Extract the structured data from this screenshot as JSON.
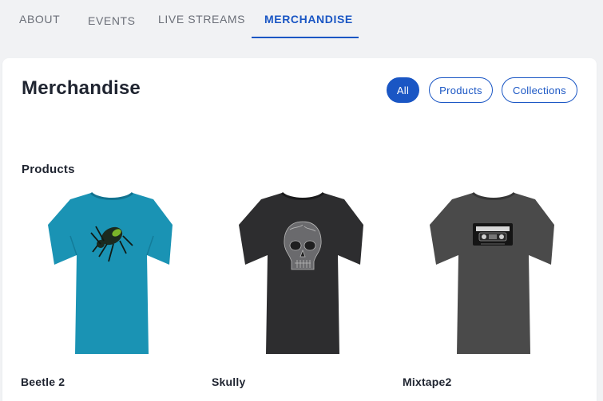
{
  "tabs": [
    {
      "label": "ABOUT",
      "active": false
    },
    {
      "label": "EVENTS",
      "active": false
    },
    {
      "label": "LIVE STREAMS",
      "active": false
    },
    {
      "label": "MERCHANDISE",
      "active": true
    }
  ],
  "page": {
    "title": "Merchandise",
    "filters": [
      {
        "label": "All",
        "active": true
      },
      {
        "label": "Products",
        "active": false
      },
      {
        "label": "Collections",
        "active": false
      }
    ],
    "section_title": "Products"
  },
  "products": [
    {
      "name": "Beetle 2",
      "shirt_color": "#1a93b4",
      "graphic": "beetle-icon"
    },
    {
      "name": "Skully",
      "shirt_color": "#2d2d2f",
      "graphic": "skull-icon"
    },
    {
      "name": "Mixtape2",
      "shirt_color": "#4a4a4a",
      "graphic": "cassette-icon"
    }
  ],
  "colors": {
    "accent": "#1a56c4",
    "background": "#f1f2f4"
  }
}
